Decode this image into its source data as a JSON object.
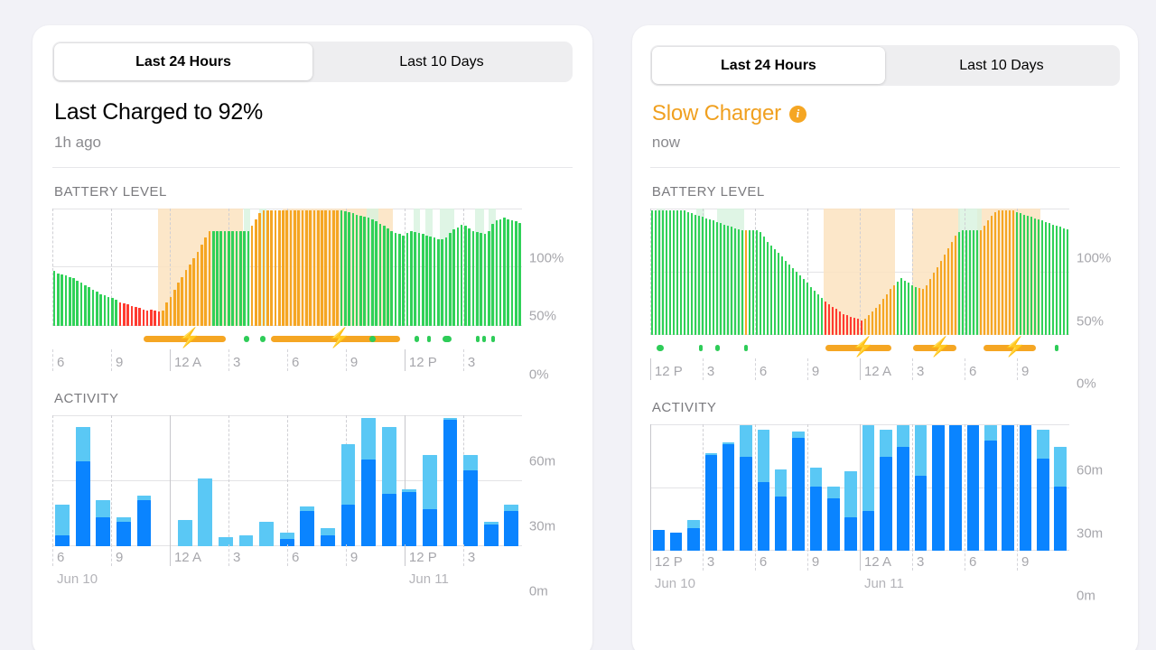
{
  "background_color": "#f2f2f7",
  "colors": {
    "green": "#30d158",
    "green_alt": "#2ecc58",
    "orange": "#f5a623",
    "red": "#ff3b30",
    "blue_dark": "#0a84ff",
    "blue_light": "#5ac8f5",
    "charge_band": "#fbe3c0",
    "screen_band": "#d7f3df",
    "muted_text": "#a7a7ac"
  },
  "panels": [
    {
      "id": "left",
      "tabs": [
        {
          "label": "Last 24 Hours",
          "active": true
        },
        {
          "label": "Last 10 Days",
          "active": false
        }
      ],
      "status": {
        "title": "Last Charged to 92%",
        "subtitle": "1h ago",
        "warning": false,
        "info_icon": false
      },
      "battery": {
        "section_label": "BATTERY LEVEL",
        "y_labels": [
          "100%",
          "50%",
          "0%"
        ],
        "x_labels": [
          "6",
          "9",
          "12 A",
          "3",
          "6",
          "9",
          "12 P",
          "3"
        ],
        "day_labels": [
          "Jun 10",
          "Jun 11"
        ]
      },
      "activity": {
        "section_label": "ACTIVITY",
        "y_labels": [
          "60m",
          "30m",
          "0m"
        ],
        "x_labels": [
          "6",
          "9",
          "12 A",
          "3",
          "6",
          "9",
          "12 P",
          "3"
        ],
        "day_labels": [
          "Jun 10",
          "Jun 11"
        ]
      }
    },
    {
      "id": "right",
      "tabs": [
        {
          "label": "Last 24 Hours",
          "active": true
        },
        {
          "label": "Last 10 Days",
          "active": false
        }
      ],
      "status": {
        "title": "Slow Charger",
        "subtitle": "now",
        "warning": true,
        "info_icon": true,
        "info_icon_name": "info-icon",
        "info_icon_glyph": "i"
      },
      "battery": {
        "section_label": "BATTERY LEVEL",
        "y_labels": [
          "100%",
          "50%",
          "0%"
        ],
        "x_labels": [
          "12 P",
          "3",
          "6",
          "9",
          "12 A",
          "3",
          "6",
          "9"
        ],
        "day_labels": []
      },
      "activity": {
        "section_label": "ACTIVITY",
        "y_labels": [
          "60m",
          "30m",
          "0m"
        ],
        "x_labels": [
          "12 P",
          "3",
          "6",
          "9",
          "12 A",
          "3",
          "6",
          "9"
        ],
        "day_labels": [
          "Jun 10",
          "Jun 11"
        ]
      }
    }
  ],
  "chart_data": [
    {
      "id": "left-battery",
      "type": "bar",
      "title": "BATTERY LEVEL",
      "ylabel": "Battery percent",
      "ylim": [
        0,
        100
      ],
      "ytick_labels": [
        "0%",
        "50%",
        "100%"
      ],
      "ytick_values": [
        0,
        50,
        100
      ],
      "xlabel": "",
      "xtick_labels": [
        "6",
        "9",
        "12 A",
        "3",
        "6",
        "9",
        "12 P",
        "3"
      ],
      "xtick_hours": [
        6,
        9,
        12,
        15,
        18,
        21,
        24,
        27
      ],
      "grid": true,
      "legend": "none",
      "bar_state_legend": {
        "green": "discharging normal",
        "red": "low battery",
        "orange": "charging"
      },
      "values": [
        47,
        45,
        44,
        43,
        42,
        41,
        39,
        37,
        35,
        33,
        31,
        29,
        27,
        26,
        25,
        24,
        22,
        20,
        19,
        18,
        17,
        16,
        15,
        14,
        13,
        14,
        13,
        12,
        13,
        20,
        25,
        31,
        37,
        42,
        48,
        53,
        58,
        64,
        70,
        76,
        82,
        82,
        82,
        82,
        82,
        82,
        82,
        82,
        82,
        82,
        82,
        86,
        92,
        97,
        100,
        100,
        100,
        100,
        100,
        100,
        100,
        100,
        100,
        100,
        100,
        100,
        100,
        100,
        100,
        100,
        100,
        100,
        100,
        100,
        100,
        99,
        98,
        97,
        96,
        95,
        94,
        93,
        92,
        90,
        88,
        86,
        84,
        82,
        80,
        79,
        78,
        80,
        82,
        81,
        80,
        79,
        78,
        77,
        76,
        75,
        75,
        76,
        80,
        83,
        85,
        87,
        86,
        84,
        82,
        81,
        80,
        79,
        82,
        88,
        91,
        92,
        93,
        92,
        91,
        90,
        89
      ],
      "states": [
        "green",
        "green",
        "green",
        "green",
        "green",
        "green",
        "green",
        "green",
        "green",
        "green",
        "green",
        "green",
        "green",
        "green",
        "green",
        "green",
        "green",
        "red",
        "red",
        "red",
        "red",
        "red",
        "red",
        "red",
        "red",
        "red",
        "red",
        "red",
        "orange",
        "orange",
        "orange",
        "orange",
        "orange",
        "orange",
        "orange",
        "orange",
        "orange",
        "orange",
        "orange",
        "orange",
        "orange",
        "green",
        "green",
        "green",
        "green",
        "green",
        "green",
        "green",
        "green",
        "green",
        "green",
        "orange",
        "orange",
        "orange",
        "orange",
        "orange",
        "orange",
        "orange",
        "orange",
        "orange",
        "orange",
        "orange",
        "orange",
        "orange",
        "orange",
        "orange",
        "orange",
        "orange",
        "orange",
        "orange",
        "orange",
        "orange",
        "orange",
        "orange",
        "green",
        "green",
        "green",
        "green",
        "green",
        "green",
        "green",
        "green",
        "green",
        "green",
        "green",
        "green",
        "green",
        "green",
        "green",
        "green",
        "green",
        "green",
        "green",
        "green",
        "green",
        "green",
        "green",
        "green",
        "green",
        "green",
        "green",
        "green",
        "green",
        "green",
        "green",
        "green",
        "green",
        "green",
        "green",
        "green",
        "green",
        "green",
        "green",
        "green",
        "green",
        "green",
        "green",
        "green",
        "green"
      ],
      "charge_bands": [
        {
          "start_pct": 22.5,
          "end_pct": 40.5
        },
        {
          "start_pct": 49.0,
          "end_pct": 72.5
        }
      ],
      "screen_bands": [
        {
          "start_pct": 40.7,
          "end_pct": 42.2
        },
        {
          "start_pct": 44.0,
          "end_pct": 45.5
        },
        {
          "start_pct": 67.0,
          "end_pct": 69.5
        },
        {
          "start_pct": 77.0,
          "end_pct": 78.2
        },
        {
          "start_pct": 79.5,
          "end_pct": 81.0
        },
        {
          "start_pct": 82.5,
          "end_pct": 85.5
        },
        {
          "start_pct": 90.0,
          "end_pct": 92.0
        },
        {
          "start_pct": 93.0,
          "end_pct": 94.5
        }
      ],
      "charge_pills": [
        {
          "start_pct": 19.5,
          "end_pct": 37.0
        },
        {
          "start_pct": 46.5,
          "end_pct": 74.0
        }
      ],
      "screen_dots": [
        {
          "start_pct": 40.8,
          "end_pct": 42.0
        },
        {
          "start_pct": 44.2,
          "end_pct": 45.4
        },
        {
          "start_pct": 67.6,
          "end_pct": 68.8
        },
        {
          "start_pct": 77.2,
          "end_pct": 78.0
        },
        {
          "start_pct": 79.8,
          "end_pct": 80.6
        },
        {
          "start_pct": 83.0,
          "end_pct": 85.0
        },
        {
          "start_pct": 90.2,
          "end_pct": 91.0
        },
        {
          "start_pct": 91.6,
          "end_pct": 92.2
        },
        {
          "start_pct": 93.4,
          "end_pct": 94.2
        }
      ]
    },
    {
      "id": "left-activity",
      "type": "bar",
      "title": "ACTIVITY",
      "ylabel": "Minutes",
      "ylim": [
        0,
        60
      ],
      "ytick_labels": [
        "0m",
        "30m",
        "60m"
      ],
      "ytick_values": [
        0,
        30,
        60
      ],
      "xtick_labels": [
        "6",
        "9",
        "12 A",
        "3",
        "6",
        "9",
        "12 P",
        "3"
      ],
      "grid": true,
      "stacked": true,
      "series": [
        {
          "name": "Screen On",
          "color": "#0a84ff",
          "values": [
            5,
            39,
            13,
            11,
            21,
            0,
            0,
            0,
            0,
            0,
            0,
            3,
            16,
            5,
            19,
            40,
            24,
            25,
            17,
            58,
            35,
            10,
            16
          ]
        },
        {
          "name": "Screen Off",
          "color": "#5ac8f5",
          "values": [
            14,
            16,
            8,
            2,
            2,
            0,
            12,
            31,
            4,
            5,
            11,
            3,
            2,
            3,
            28,
            19,
            31,
            1,
            25,
            1,
            7,
            1,
            3
          ]
        }
      ],
      "bar_count": 23
    },
    {
      "id": "right-battery",
      "type": "bar",
      "title": "BATTERY LEVEL",
      "ylabel": "Battery percent",
      "ylim": [
        0,
        100
      ],
      "ytick_labels": [
        "0%",
        "50%",
        "100%"
      ],
      "ytick_values": [
        0,
        50,
        100
      ],
      "xtick_labels": [
        "12 P",
        "3",
        "6",
        "9",
        "12 A",
        "3",
        "6",
        "9"
      ],
      "grid": true,
      "bar_state_legend": {
        "green": "discharging normal",
        "red": "low battery",
        "orange": "charging"
      },
      "values": [
        100,
        100,
        100,
        100,
        100,
        100,
        100,
        100,
        100,
        100,
        99,
        98,
        97,
        96,
        95,
        94,
        93,
        92,
        91,
        90,
        89,
        88,
        87,
        86,
        85,
        84,
        84,
        84,
        84,
        84,
        83,
        79,
        75,
        72,
        69,
        66,
        63,
        60,
        57,
        54,
        51,
        48,
        45,
        42,
        39,
        36,
        33,
        30,
        27,
        25,
        23,
        21,
        19,
        17,
        16,
        15,
        14,
        13,
        12,
        13,
        16,
        19,
        22,
        25,
        29,
        33,
        37,
        40,
        43,
        46,
        44,
        42,
        40,
        39,
        38,
        37,
        40,
        45,
        50,
        55,
        60,
        65,
        70,
        75,
        80,
        83,
        84,
        84,
        84,
        84,
        84,
        84,
        88,
        92,
        96,
        99,
        100,
        100,
        100,
        100,
        100,
        99,
        98,
        97,
        96,
        95,
        94,
        93,
        92,
        91,
        90,
        89,
        88,
        87,
        86,
        85
      ],
      "states": [
        "green",
        "green",
        "green",
        "green",
        "green",
        "green",
        "green",
        "green",
        "green",
        "green",
        "green",
        "green",
        "green",
        "green",
        "green",
        "green",
        "green",
        "green",
        "green",
        "green",
        "green",
        "green",
        "green",
        "green",
        "green",
        "green",
        "orange",
        "green",
        "green",
        "green",
        "green",
        "green",
        "green",
        "green",
        "green",
        "green",
        "green",
        "green",
        "green",
        "green",
        "green",
        "green",
        "green",
        "green",
        "green",
        "green",
        "green",
        "green",
        "red",
        "red",
        "red",
        "red",
        "red",
        "red",
        "red",
        "red",
        "red",
        "red",
        "red",
        "orange",
        "orange",
        "orange",
        "orange",
        "orange",
        "orange",
        "orange",
        "orange",
        "orange",
        "green",
        "green",
        "green",
        "green",
        "green",
        "green",
        "orange",
        "orange",
        "orange",
        "orange",
        "orange",
        "orange",
        "orange",
        "orange",
        "orange",
        "orange",
        "orange",
        "green",
        "green",
        "green",
        "green",
        "green",
        "green",
        "orange",
        "orange",
        "orange",
        "orange",
        "orange",
        "orange",
        "orange",
        "orange",
        "orange",
        "orange",
        "green",
        "green",
        "green",
        "green",
        "green",
        "green",
        "green",
        "green",
        "green",
        "green",
        "green",
        "green",
        "green",
        "green",
        "green",
        "green"
      ],
      "charge_bands": [
        {
          "start_pct": 41.5,
          "end_pct": 58.5
        },
        {
          "start_pct": 62.5,
          "end_pct": 74.0
        },
        {
          "start_pct": 78.0,
          "end_pct": 93.0
        }
      ],
      "screen_bands": [
        {
          "start_pct": 11.0,
          "end_pct": 13.0
        },
        {
          "start_pct": 16.0,
          "end_pct": 22.5
        },
        {
          "start_pct": 1.5,
          "end_pct": 3.5
        },
        {
          "start_pct": 73.5,
          "end_pct": 79.0
        }
      ],
      "charge_pills": [
        {
          "start_pct": 41.8,
          "end_pct": 57.5
        },
        {
          "start_pct": 62.8,
          "end_pct": 73.0
        },
        {
          "start_pct": 79.5,
          "end_pct": 92.0
        }
      ],
      "screen_dots": [
        {
          "start_pct": 1.6,
          "end_pct": 3.2
        },
        {
          "start_pct": 11.6,
          "end_pct": 12.6
        },
        {
          "start_pct": 15.6,
          "end_pct": 16.6
        },
        {
          "start_pct": 22.4,
          "end_pct": 23.2
        },
        {
          "start_pct": 96.5,
          "end_pct": 97.5
        }
      ]
    },
    {
      "id": "right-activity",
      "type": "bar",
      "title": "ACTIVITY",
      "ylabel": "Minutes",
      "ylim": [
        0,
        60
      ],
      "ytick_labels": [
        "0m",
        "30m",
        "60m"
      ],
      "ytick_values": [
        0,
        30,
        60
      ],
      "xtick_labels": [
        "12 P",
        "3",
        "6",
        "9",
        "12 A",
        "3",
        "6",
        "9"
      ],
      "grid": true,
      "stacked": true,
      "series": [
        {
          "name": "Screen On",
          "color": "#0a84ff",
          "values": [
            10,
            9,
            11,
            46,
            51,
            45,
            33,
            26,
            54,
            31,
            25,
            16,
            19,
            45,
            50,
            36,
            60,
            60,
            60,
            53,
            60,
            60,
            44,
            31
          ]
        },
        {
          "name": "Screen Off",
          "color": "#5ac8f5",
          "values": [
            0,
            0,
            4,
            1,
            1,
            15,
            25,
            13,
            3,
            9,
            6,
            22,
            41,
            13,
            10,
            24,
            0,
            0,
            0,
            7,
            0,
            0,
            14,
            19
          ]
        }
      ],
      "bar_count": 24
    }
  ]
}
